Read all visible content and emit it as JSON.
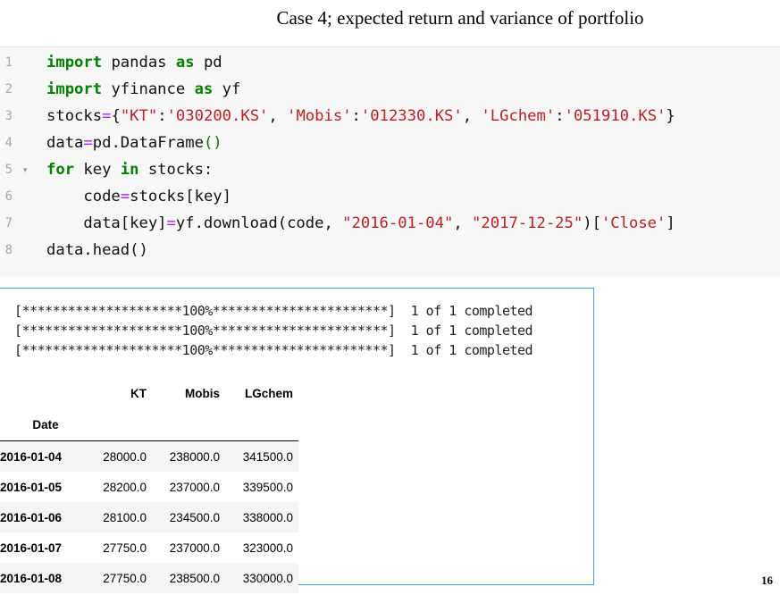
{
  "slide": {
    "title": "Case 4; expected return and variance of portfolio",
    "page_number": "16"
  },
  "code_cell": {
    "line_numbers": [
      "1",
      "2",
      "3",
      "4",
      "5",
      "6",
      "7",
      "8"
    ],
    "fold_marker": "▾",
    "tokens": {
      "l1_import": "import",
      "l1_mod": " pandas ",
      "l1_as": "as",
      "l1_alias": " pd",
      "l2_import": "import",
      "l2_mod": " yfinance ",
      "l2_as": "as",
      "l2_alias": " yf",
      "l3_a": "stocks",
      "l3_eq": "=",
      "l3_b": "{",
      "l3_k1": "\"KT\"",
      "l3_c1": ":",
      "l3_v1": "'030200.KS'",
      "l3_sep1": ", ",
      "l3_k2": "'Mobis'",
      "l3_c2": ":",
      "l3_v2": "'012330.KS'",
      "l3_sep2": ", ",
      "l3_k3": "'LGchem'",
      "l3_c3": ":",
      "l3_v3": "'051910.KS'",
      "l3_end": "}",
      "l4_a": "data",
      "l4_eq": "=",
      "l4_b": "pd.DataFrame",
      "l4_p": "()",
      "l5_for": "for",
      "l5_a": " key ",
      "l5_in": "in",
      "l5_b": " stocks:",
      "l6_a": "    code",
      "l6_eq": "=",
      "l6_b": "stocks[key]",
      "l7_a": "    data[key]",
      "l7_eq": "=",
      "l7_b": "yf.download(code, ",
      "l7_s1": "\"2016-01-04\"",
      "l7_c": ", ",
      "l7_s2": "\"2017-12-25\"",
      "l7_d": ")[",
      "l7_s3": "'Close'",
      "l7_e": "]",
      "l8": "data.head()"
    }
  },
  "output": {
    "progress_lines": [
      "[*********************100%***********************]  1 of 1 completed",
      "[*********************100%***********************]  1 of 1 completed",
      "[*********************100%***********************]  1 of 1 completed"
    ],
    "dataframe": {
      "columns": [
        "KT",
        "Mobis",
        "LGchem"
      ],
      "index_name": "Date",
      "rows": [
        {
          "date": "2016-01-04",
          "KT": "28000.0",
          "Mobis": "238000.0",
          "LGchem": "341500.0"
        },
        {
          "date": "2016-01-05",
          "KT": "28200.0",
          "Mobis": "237000.0",
          "LGchem": "339500.0"
        },
        {
          "date": "2016-01-06",
          "KT": "28100.0",
          "Mobis": "234500.0",
          "LGchem": "338000.0"
        },
        {
          "date": "2016-01-07",
          "KT": "27750.0",
          "Mobis": "237000.0",
          "LGchem": "323000.0"
        },
        {
          "date": "2016-01-08",
          "KT": "27750.0",
          "Mobis": "238500.0",
          "LGchem": "330000.0"
        }
      ]
    }
  },
  "colors": {
    "keyword": "#008000",
    "string": "#ba2121",
    "operator": "#aa22ff",
    "output_border": "#4a9fd6",
    "cell_background": "#f7f7f7"
  }
}
